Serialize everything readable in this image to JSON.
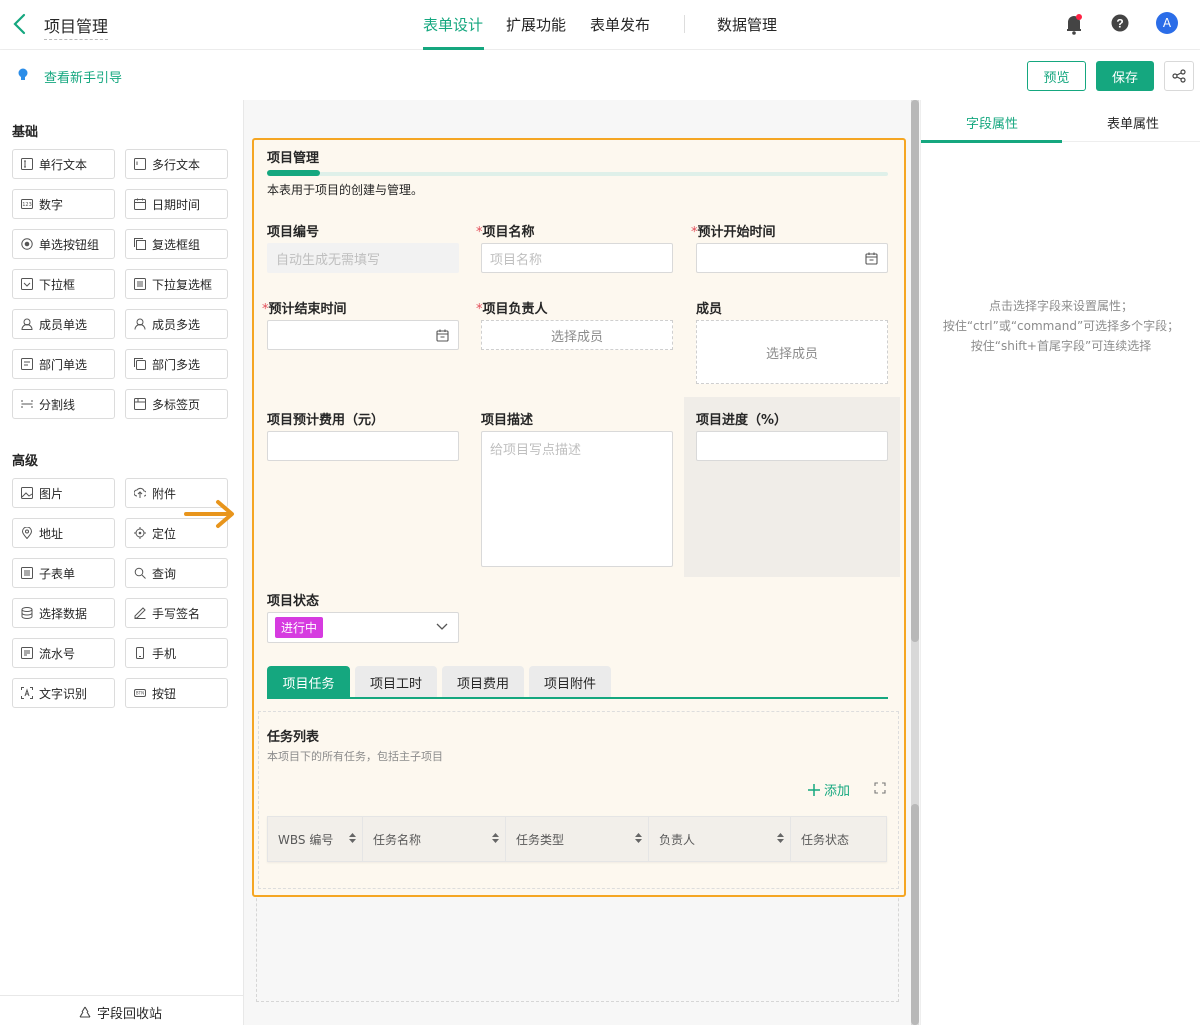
{
  "header": {
    "title": "项目管理",
    "tabs": [
      "表单设计",
      "扩展功能",
      "表单发布",
      "数据管理"
    ],
    "active_tab": "表单设计",
    "avatar_letter": "A"
  },
  "subbar": {
    "guide": "查看新手引导",
    "preview": "预览",
    "save": "保存"
  },
  "sidebar": {
    "basic_title": "基础",
    "basic": [
      "单行文本",
      "多行文本",
      "数字",
      "日期时间",
      "单选按钮组",
      "复选框组",
      "下拉框",
      "下拉复选框",
      "成员单选",
      "成员多选",
      "部门单选",
      "部门多选",
      "分割线",
      "多标签页"
    ],
    "advanced_title": "高级",
    "advanced": [
      "图片",
      "附件",
      "地址",
      "定位",
      "子表单",
      "查询",
      "选择数据",
      "手写签名",
      "流水号",
      "手机",
      "文字识别",
      "按钮"
    ],
    "recycle": "字段回收站"
  },
  "form": {
    "title": "项目管理",
    "description": "本表用于项目的创建与管理。",
    "fields": {
      "code": {
        "label": "项目编号",
        "placeholder": "自动生成无需填写"
      },
      "name": {
        "label": "项目名称",
        "placeholder": "项目名称",
        "required": "*"
      },
      "start": {
        "label": "预计开始时间",
        "required": "*"
      },
      "end": {
        "label": "预计结束时间",
        "required": "*"
      },
      "owner": {
        "label": "项目负责人",
        "placeholder": "选择成员",
        "required": "*"
      },
      "members": {
        "label": "成员",
        "placeholder": "选择成员"
      },
      "cost": {
        "label": "项目预计费用（元）"
      },
      "desc": {
        "label": "项目描述",
        "placeholder": "给项目写点描述"
      },
      "progress": {
        "label": "项目进度（%）"
      },
      "status": {
        "label": "项目状态",
        "value": "进行中",
        "tag_color": "#d63be0"
      }
    },
    "tabs": [
      "项目任务",
      "项目工时",
      "项目费用",
      "项目附件"
    ],
    "active_tab": "项目任务",
    "subtable": {
      "title": "任务列表",
      "subtitle": "本项目下的所有任务，包括主子项目",
      "add": "添加",
      "columns": [
        "WBS 编号",
        "任务名称",
        "任务类型",
        "负责人",
        "任务状态"
      ]
    }
  },
  "right_panel": {
    "tabs": [
      "字段属性",
      "表单属性"
    ],
    "active_tab": "字段属性",
    "hint": [
      "点击选择字段来设置属性；",
      "按住“ctrl”或“command”可选择多个字段；",
      "按住“shift+首尾字段”可连续选择"
    ]
  },
  "colors": {
    "accent": "#15a77f",
    "highlight": "#f5a623",
    "arrow": "#e8951c"
  }
}
